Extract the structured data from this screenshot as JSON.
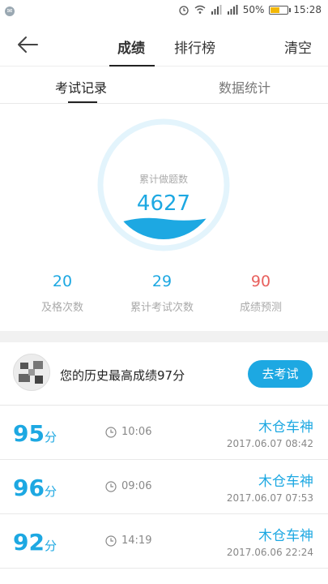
{
  "status_bar": {
    "battery": "50%",
    "time": "15:28"
  },
  "topbar": {
    "tab_scores": "成绩",
    "tab_ranking": "排行榜",
    "clear_label": "清空"
  },
  "subtabs": {
    "exam_records": "考试记录",
    "data_stats": "数据统计"
  },
  "summary": {
    "circle_label": "累计做题数",
    "circle_value": "4627",
    "stats": [
      {
        "value": "20",
        "label": "及格次数"
      },
      {
        "value": "29",
        "label": "累计考试次数"
      },
      {
        "value": "90",
        "label": "成绩预测"
      }
    ]
  },
  "best": {
    "text": "您的历史最高成绩97分",
    "button_label": "去考试"
  },
  "records": [
    {
      "score": "95",
      "unit": "分",
      "time": "10:06",
      "name": "木仓车神",
      "date": "2017.06.07  08:42"
    },
    {
      "score": "96",
      "unit": "分",
      "time": "09:06",
      "name": "木仓车神",
      "date": "2017.06.07  07:53"
    },
    {
      "score": "92",
      "unit": "分",
      "time": "14:19",
      "name": "木仓车神",
      "date": "2017.06.06  22:24"
    }
  ],
  "colors": {
    "accent": "#1da8e2",
    "prediction": "#e8605d"
  }
}
